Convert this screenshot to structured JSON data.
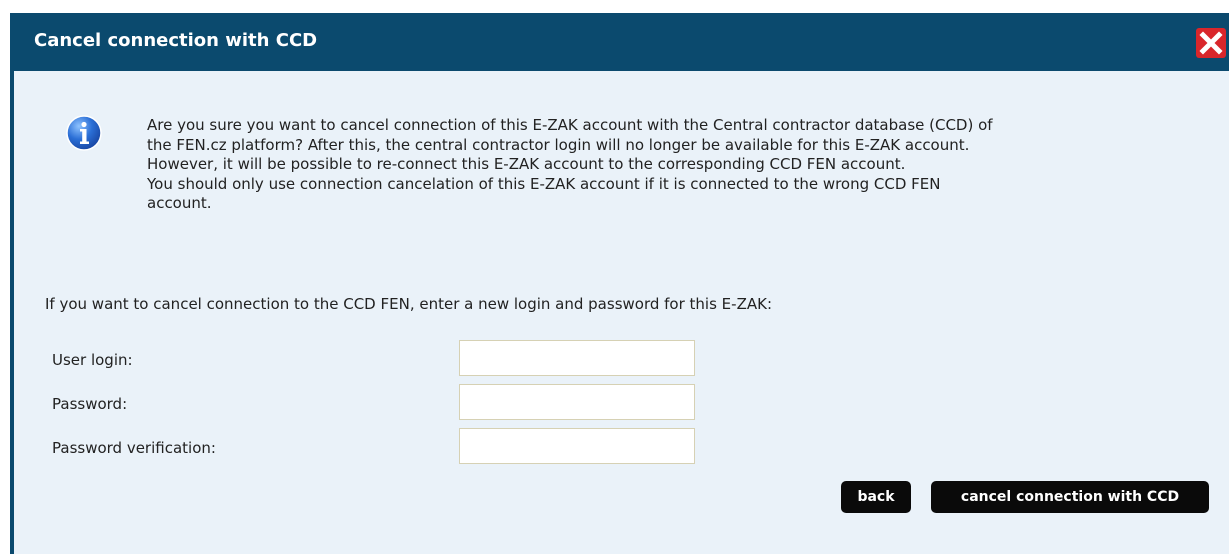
{
  "dialog": {
    "title": "Cancel connection with CCD",
    "close_icon": "close-x-icon",
    "info_icon": "info-icon",
    "message_lines": [
      "Are you sure you want to cancel connection of this E-ZAK account with the Central contractor database (CCD) of",
      "the FEN.cz platform? After this, the central contractor login will no longer be available for this E-ZAK account.",
      "However, it will be possible to re-connect this E-ZAK account to the corresponding CCD FEN account.",
      "You should only use connection cancelation of this E-ZAK account if it is connected to the wrong CCD FEN",
      "account."
    ],
    "prompt": "If you want to cancel connection to the CCD FEN, enter a new login and password for this E-ZAK:"
  },
  "form": {
    "user_login_label": "User login:",
    "user_login_value": "",
    "password_label": "Password:",
    "password_value": "",
    "password_verification_label": "Password verification:",
    "password_verification_value": ""
  },
  "buttons": {
    "back": "back",
    "cancel_connection": "cancel connection with CCD"
  },
  "colors": {
    "titlebar": "#0b4a6e",
    "body_bg": "#eaf2f9",
    "close_bg": "#d9262b",
    "button_bg": "#0a0a0a",
    "field_border": "#d6d1b4",
    "info_blue": "#2b6fd6"
  }
}
